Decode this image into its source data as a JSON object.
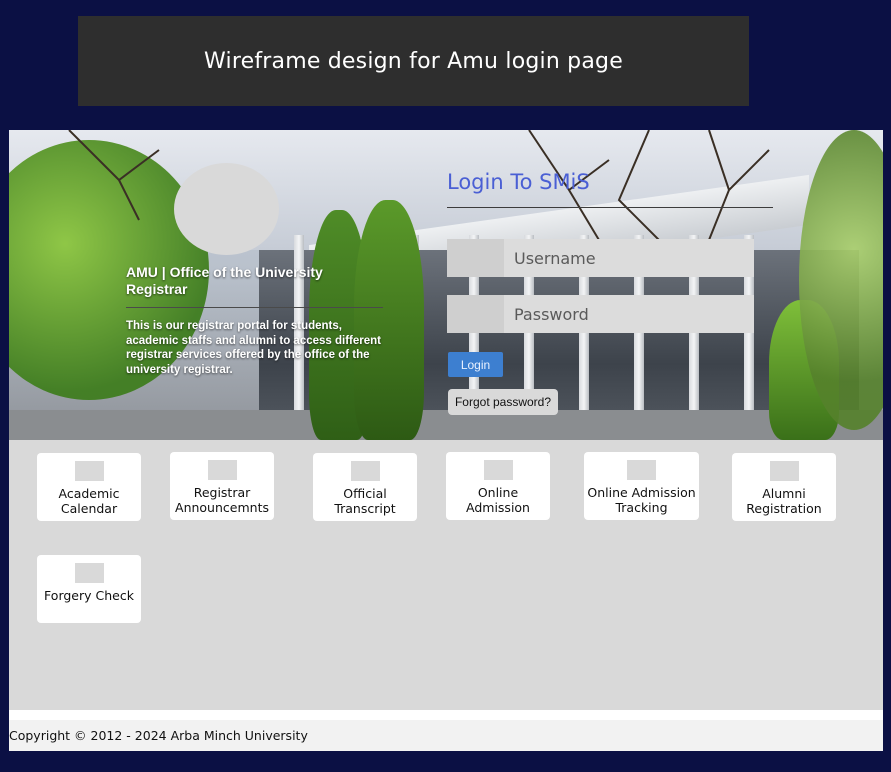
{
  "header": {
    "title": "Wireframe design for Amu login page"
  },
  "org": {
    "title": "AMU | Office of the University Registrar",
    "description": "This is our registrar portal for students, academic staffs and alumni to access different registrar services offered by the office of the university registrar."
  },
  "login": {
    "title": "Login To SMiS",
    "username_label": "Username",
    "password_label": "Password",
    "login_label": "Login",
    "forgot_label": "Forgot password?"
  },
  "services": [
    {
      "label": "Academic Calendar"
    },
    {
      "label": "Registrar Announcemnts"
    },
    {
      "label": "Official Transcript"
    },
    {
      "label": "Online Admission"
    },
    {
      "label": "Online Admission Tracking"
    },
    {
      "label": "Alumni Registration"
    },
    {
      "label": "Forgery Check"
    }
  ],
  "footer": {
    "copyright": "Copyright © 2012 - 2024 Arba Minch University"
  },
  "colors": {
    "background": "#0b1044",
    "accent": "#4a5fd4",
    "button": "#3d7fd0"
  }
}
